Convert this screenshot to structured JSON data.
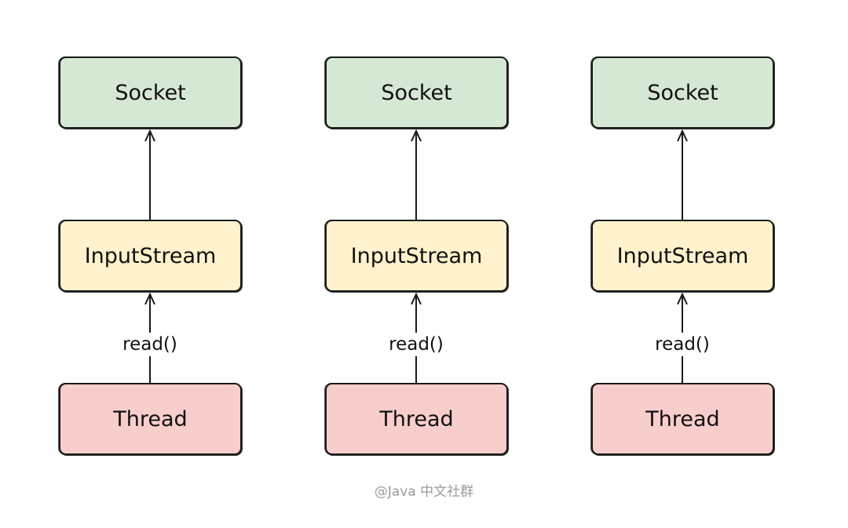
{
  "diagram": {
    "columns": [
      {
        "top": "Socket",
        "middle": "InputStream",
        "bottom": "Thread",
        "edge_label": "read()"
      },
      {
        "top": "Socket",
        "middle": "InputStream",
        "bottom": "Thread",
        "edge_label": "read()"
      },
      {
        "top": "Socket",
        "middle": "InputStream",
        "bottom": "Thread",
        "edge_label": "read()"
      }
    ],
    "colors": {
      "socket": "#d5e8d4",
      "inputstream": "#fff2cc",
      "thread": "#f8cecc",
      "stroke": "#1a1a1a"
    },
    "edges": [
      "InputStream -> Socket",
      "Thread -> InputStream (read())"
    ]
  },
  "watermark": "@Java 中文社群"
}
